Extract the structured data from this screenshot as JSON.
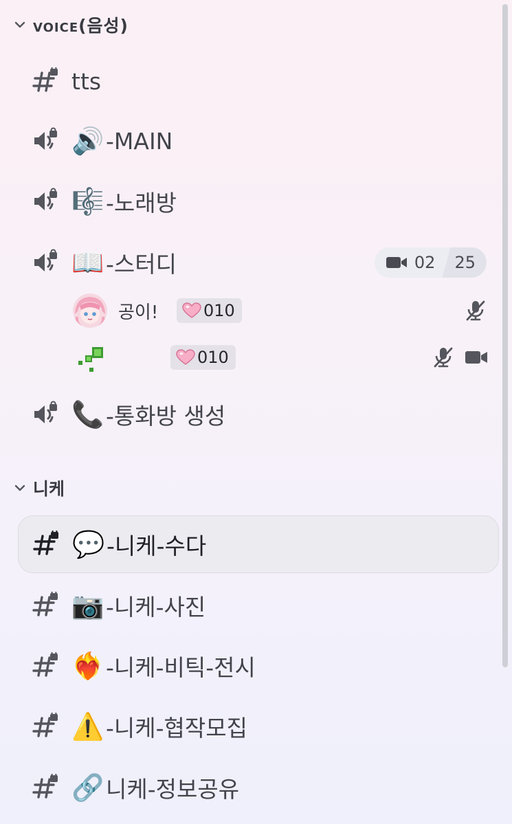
{
  "categories": [
    {
      "label": "voice(음성)"
    },
    {
      "label": "니케"
    }
  ],
  "voice_channels": [
    {
      "emoji": "",
      "name": "tts",
      "type": "text-locked"
    },
    {
      "emoji": "🔊",
      "name": "-MAIN",
      "type": "voice-locked"
    },
    {
      "emoji": "🎼",
      "name": "-노래방",
      "type": "voice-locked"
    },
    {
      "emoji": "📖",
      "name": "-스터디",
      "type": "voice-locked"
    },
    {
      "emoji": "📞",
      "name": "-통화방 생성",
      "type": "voice-locked"
    }
  ],
  "study_live": {
    "left_value": "02",
    "right_value": "25"
  },
  "voice_users": [
    {
      "name": "공이!",
      "badge": "010",
      "icons": [
        "mic-muted-icon"
      ]
    },
    {
      "name": "",
      "badge": "010",
      "icons": [
        "mic-muted-icon",
        "video-camera-icon"
      ]
    }
  ],
  "nikke_channels": [
    {
      "emoji": "💬",
      "name": "-니케-수다",
      "selected": true
    },
    {
      "emoji": "📷",
      "name": "-니케-사진",
      "selected": false
    },
    {
      "emoji": "❤️‍🔥",
      "name": "-니케-비틱-전시",
      "selected": false
    },
    {
      "emoji": "⚠️",
      "name": "-니케-협작모집",
      "selected": false
    },
    {
      "emoji": "🔗",
      "name": "니케-정보공유",
      "selected": false
    }
  ],
  "colors": {
    "badge_bg": "#e4e1e8",
    "selected_bg": "#ecebf0",
    "text": "#43444b"
  }
}
